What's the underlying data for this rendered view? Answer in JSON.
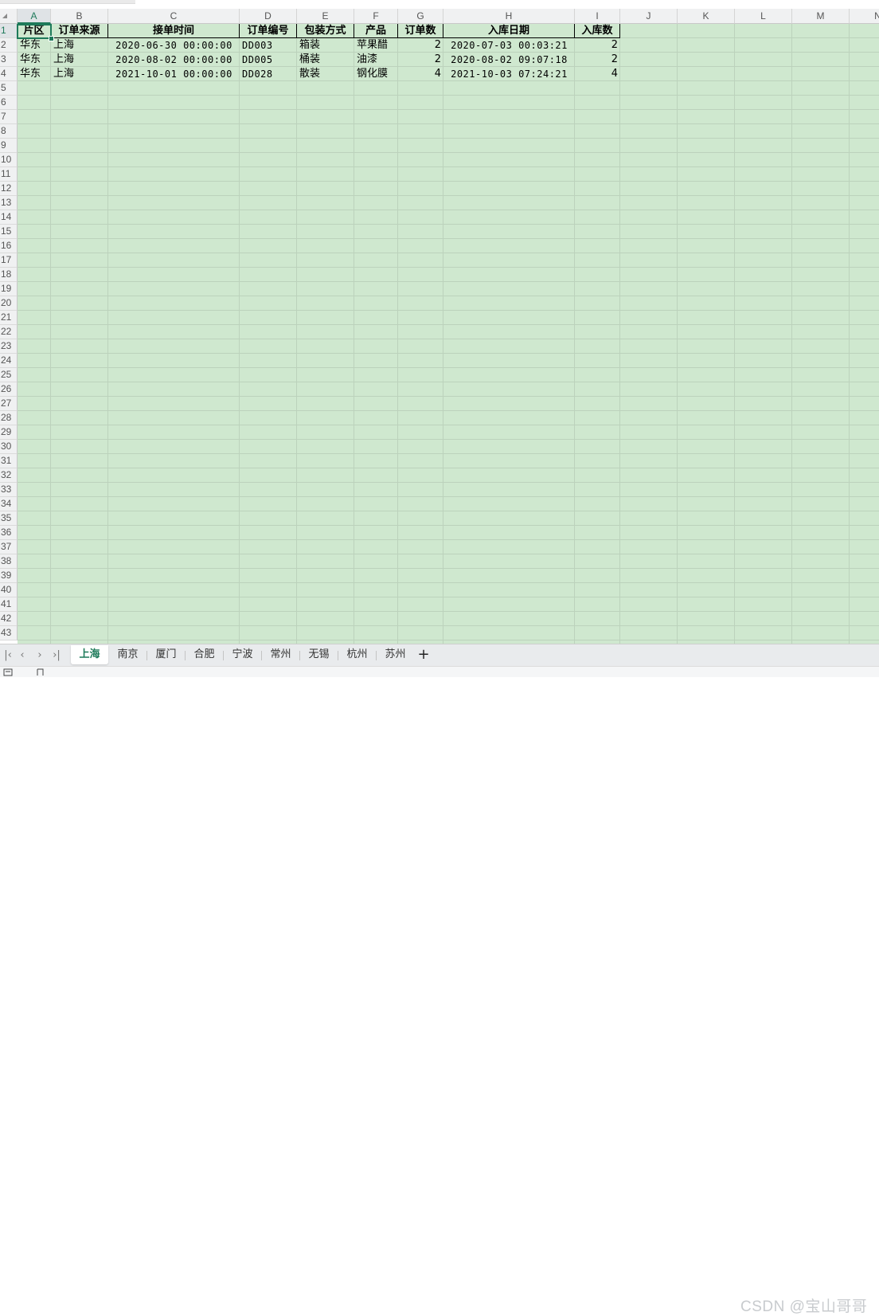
{
  "columns": [
    "A",
    "B",
    "C",
    "D",
    "E",
    "F",
    "G",
    "H",
    "I",
    "J",
    "K",
    "L",
    "M",
    "N"
  ],
  "selected_column": "A",
  "selected_row": "1",
  "header_row": {
    "A": "片区",
    "B": "订单来源",
    "C": "接单时间",
    "D": "订单编号",
    "E": "包装方式",
    "F": "产品",
    "G": "订单数",
    "H": "入库日期",
    "I": "入库数"
  },
  "rows": [
    {
      "A": "华东",
      "B": "上海",
      "C": "2020-06-30 00:00:00",
      "D": "DD003",
      "E": "箱装",
      "F": "苹果醋",
      "G": "2",
      "H": "2020-07-03 00:03:21",
      "I": "2"
    },
    {
      "A": "华东",
      "B": "上海",
      "C": "2020-08-02 00:00:00",
      "D": "DD005",
      "E": "桶装",
      "F": "油漆",
      "G": "2",
      "H": "2020-08-02 09:07:18",
      "I": "2"
    },
    {
      "A": "华东",
      "B": "上海",
      "C": "2021-10-01 00:00:00",
      "D": "DD028",
      "E": "散装",
      "F": "钢化膜",
      "G": "4",
      "H": "2021-10-03 07:24:21",
      "I": "4"
    }
  ],
  "row_numbers": [
    "1",
    "2",
    "3",
    "4",
    "5",
    "6",
    "7",
    "8",
    "9",
    "10",
    "11",
    "12",
    "13",
    "14",
    "15",
    "16",
    "17",
    "18",
    "19",
    "20",
    "21",
    "22",
    "23",
    "24",
    "25",
    "26",
    "27",
    "28",
    "29",
    "30",
    "31",
    "32",
    "33",
    "34",
    "35",
    "36",
    "37",
    "38",
    "39",
    "40",
    "41",
    "42",
    "43"
  ],
  "sheet_tabs": [
    "上海",
    "南京",
    "厦门",
    "合肥",
    "宁波",
    "常州",
    "无锡",
    "杭州",
    "苏州"
  ],
  "active_tab": "上海",
  "add_sheet_label": "+",
  "nav": {
    "first": "⏮",
    "prev": "‹",
    "next": "›",
    "last": "⏭"
  },
  "watermark": "CSDN @宝山哥哥",
  "colors": {
    "grid_fill": "#cfe8cf",
    "accent": "#1e7a5a"
  },
  "status_icons": [
    "macro-icon",
    "sheet-view-icon"
  ]
}
